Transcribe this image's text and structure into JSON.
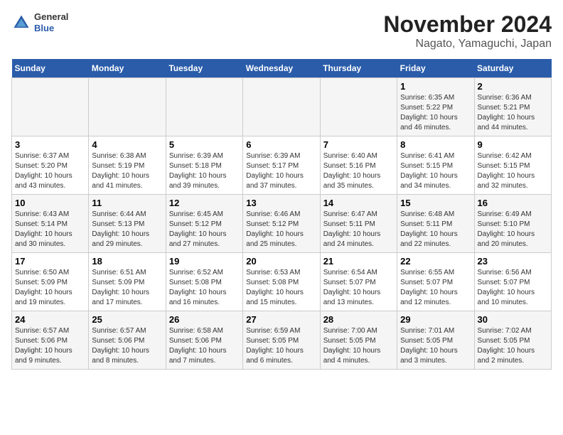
{
  "logo": {
    "general": "General",
    "blue": "Blue"
  },
  "header": {
    "month": "November 2024",
    "location": "Nagato, Yamaguchi, Japan"
  },
  "weekdays": [
    "Sunday",
    "Monday",
    "Tuesday",
    "Wednesday",
    "Thursday",
    "Friday",
    "Saturday"
  ],
  "weeks": [
    [
      {
        "day": "",
        "info": ""
      },
      {
        "day": "",
        "info": ""
      },
      {
        "day": "",
        "info": ""
      },
      {
        "day": "",
        "info": ""
      },
      {
        "day": "",
        "info": ""
      },
      {
        "day": "1",
        "info": "Sunrise: 6:35 AM\nSunset: 5:22 PM\nDaylight: 10 hours and 46 minutes."
      },
      {
        "day": "2",
        "info": "Sunrise: 6:36 AM\nSunset: 5:21 PM\nDaylight: 10 hours and 44 minutes."
      }
    ],
    [
      {
        "day": "3",
        "info": "Sunrise: 6:37 AM\nSunset: 5:20 PM\nDaylight: 10 hours and 43 minutes."
      },
      {
        "day": "4",
        "info": "Sunrise: 6:38 AM\nSunset: 5:19 PM\nDaylight: 10 hours and 41 minutes."
      },
      {
        "day": "5",
        "info": "Sunrise: 6:39 AM\nSunset: 5:18 PM\nDaylight: 10 hours and 39 minutes."
      },
      {
        "day": "6",
        "info": "Sunrise: 6:39 AM\nSunset: 5:17 PM\nDaylight: 10 hours and 37 minutes."
      },
      {
        "day": "7",
        "info": "Sunrise: 6:40 AM\nSunset: 5:16 PM\nDaylight: 10 hours and 35 minutes."
      },
      {
        "day": "8",
        "info": "Sunrise: 6:41 AM\nSunset: 5:15 PM\nDaylight: 10 hours and 34 minutes."
      },
      {
        "day": "9",
        "info": "Sunrise: 6:42 AM\nSunset: 5:15 PM\nDaylight: 10 hours and 32 minutes."
      }
    ],
    [
      {
        "day": "10",
        "info": "Sunrise: 6:43 AM\nSunset: 5:14 PM\nDaylight: 10 hours and 30 minutes."
      },
      {
        "day": "11",
        "info": "Sunrise: 6:44 AM\nSunset: 5:13 PM\nDaylight: 10 hours and 29 minutes."
      },
      {
        "day": "12",
        "info": "Sunrise: 6:45 AM\nSunset: 5:12 PM\nDaylight: 10 hours and 27 minutes."
      },
      {
        "day": "13",
        "info": "Sunrise: 6:46 AM\nSunset: 5:12 PM\nDaylight: 10 hours and 25 minutes."
      },
      {
        "day": "14",
        "info": "Sunrise: 6:47 AM\nSunset: 5:11 PM\nDaylight: 10 hours and 24 minutes."
      },
      {
        "day": "15",
        "info": "Sunrise: 6:48 AM\nSunset: 5:11 PM\nDaylight: 10 hours and 22 minutes."
      },
      {
        "day": "16",
        "info": "Sunrise: 6:49 AM\nSunset: 5:10 PM\nDaylight: 10 hours and 20 minutes."
      }
    ],
    [
      {
        "day": "17",
        "info": "Sunrise: 6:50 AM\nSunset: 5:09 PM\nDaylight: 10 hours and 19 minutes."
      },
      {
        "day": "18",
        "info": "Sunrise: 6:51 AM\nSunset: 5:09 PM\nDaylight: 10 hours and 17 minutes."
      },
      {
        "day": "19",
        "info": "Sunrise: 6:52 AM\nSunset: 5:08 PM\nDaylight: 10 hours and 16 minutes."
      },
      {
        "day": "20",
        "info": "Sunrise: 6:53 AM\nSunset: 5:08 PM\nDaylight: 10 hours and 15 minutes."
      },
      {
        "day": "21",
        "info": "Sunrise: 6:54 AM\nSunset: 5:07 PM\nDaylight: 10 hours and 13 minutes."
      },
      {
        "day": "22",
        "info": "Sunrise: 6:55 AM\nSunset: 5:07 PM\nDaylight: 10 hours and 12 minutes."
      },
      {
        "day": "23",
        "info": "Sunrise: 6:56 AM\nSunset: 5:07 PM\nDaylight: 10 hours and 10 minutes."
      }
    ],
    [
      {
        "day": "24",
        "info": "Sunrise: 6:57 AM\nSunset: 5:06 PM\nDaylight: 10 hours and 9 minutes."
      },
      {
        "day": "25",
        "info": "Sunrise: 6:57 AM\nSunset: 5:06 PM\nDaylight: 10 hours and 8 minutes."
      },
      {
        "day": "26",
        "info": "Sunrise: 6:58 AM\nSunset: 5:06 PM\nDaylight: 10 hours and 7 minutes."
      },
      {
        "day": "27",
        "info": "Sunrise: 6:59 AM\nSunset: 5:05 PM\nDaylight: 10 hours and 6 minutes."
      },
      {
        "day": "28",
        "info": "Sunrise: 7:00 AM\nSunset: 5:05 PM\nDaylight: 10 hours and 4 minutes."
      },
      {
        "day": "29",
        "info": "Sunrise: 7:01 AM\nSunset: 5:05 PM\nDaylight: 10 hours and 3 minutes."
      },
      {
        "day": "30",
        "info": "Sunrise: 7:02 AM\nSunset: 5:05 PM\nDaylight: 10 hours and 2 minutes."
      }
    ]
  ]
}
